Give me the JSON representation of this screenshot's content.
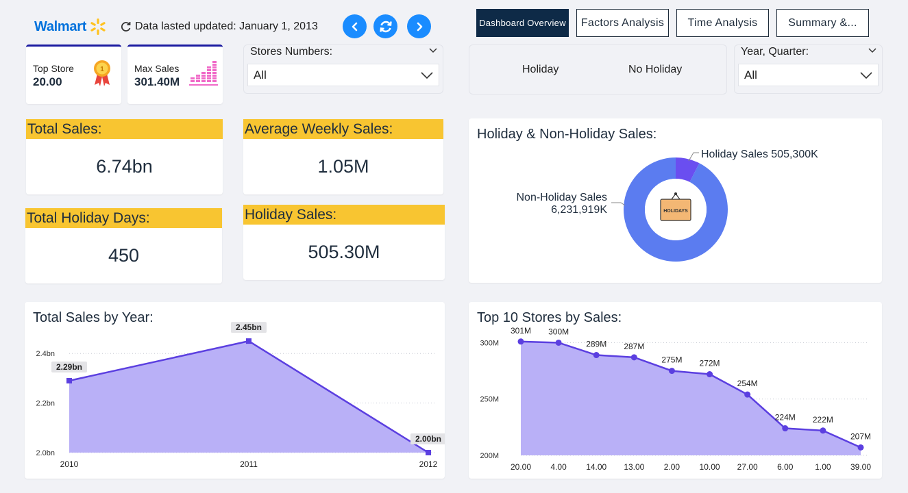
{
  "header": {
    "brand": "Walmart",
    "updated": "Data lasted updated: January 1, 2013"
  },
  "tabs": [
    "Dashboard Overview",
    "Factors Analysis",
    "Time Analysis",
    "Summary &..."
  ],
  "kpis": {
    "top_store_label": "Top Store",
    "top_store_value": "20.00",
    "max_sales_label": "Max Sales",
    "max_sales_value": "301.40M",
    "total_sales_label": "Total Sales:",
    "total_sales_value": "6.74bn",
    "avg_weekly_label": "Average Weekly Sales:",
    "avg_weekly_value": "1.05M",
    "holiday_days_label": "Total Holiday Days:",
    "holiday_days_value": "450",
    "holiday_sales_label": "Holiday Sales:",
    "holiday_sales_value": "505.30M"
  },
  "slicers": {
    "stores_title": "Stores Numbers:",
    "stores_value": "All",
    "holiday_option": "Holiday",
    "no_holiday_option": "No Holiday",
    "year_title": "Year, Quarter:",
    "year_value": "All"
  },
  "colors": {
    "accent_yellow": "#f8c531",
    "navy": "#0e2a47",
    "purple_line": "#5b3fe0",
    "purple_fill": "#b9b0f7",
    "donut_blue": "#5b7cf0",
    "donut_purple": "#6a4ef0",
    "button_blue": "#1a8cff"
  },
  "icons": {
    "walmart_spark": "spark-icon",
    "refresh_small": "refresh-icon",
    "back": "chevron-left-icon",
    "reload": "refresh-icon",
    "forward": "chevron-right-icon",
    "top_store": "medal-icon",
    "max_sales": "bar-chart-icon",
    "donut_center": "holidays-sign-icon"
  },
  "chart_data": [
    {
      "type": "pie",
      "title": "Holiday & Non-Holiday Sales:",
      "labels": [
        "Holiday Sales",
        "Non-Holiday Sales"
      ],
      "values": [
        505300,
        6231919
      ],
      "value_labels": [
        "505,300K",
        "6,231,919K"
      ],
      "colors": [
        "#6a4ef0",
        "#5b7cf0"
      ],
      "center_icon_text": "HOLIDAYS"
    },
    {
      "type": "area",
      "title": "Total Sales by Year:",
      "x": [
        "2010",
        "2011",
        "2012"
      ],
      "values": [
        2.29,
        2.45,
        2.0
      ],
      "value_labels": [
        "2.29bn",
        "2.45bn",
        "2.00bn"
      ],
      "yticks": [
        "2.0bn",
        "2.2bn",
        "2.4bn"
      ],
      "ytick_values": [
        2.0,
        2.2,
        2.4
      ],
      "ylim": [
        2.0,
        2.5
      ],
      "grid": true
    },
    {
      "type": "area",
      "title": "Top 10 Stores by Sales:",
      "x": [
        "20.00",
        "4.00",
        "14.00",
        "13.00",
        "2.00",
        "10.00",
        "27.00",
        "6.00",
        "1.00",
        "39.00"
      ],
      "values": [
        301,
        300,
        289,
        287,
        275,
        272,
        254,
        224,
        222,
        207
      ],
      "value_labels": [
        "301M",
        "300M",
        "289M",
        "287M",
        "275M",
        "272M",
        "254M",
        "224M",
        "222M",
        "207M"
      ],
      "yticks": [
        "200M",
        "250M",
        "300M"
      ],
      "ytick_values": [
        200,
        250,
        300
      ],
      "ylim": [
        200,
        310
      ],
      "grid": true
    }
  ]
}
